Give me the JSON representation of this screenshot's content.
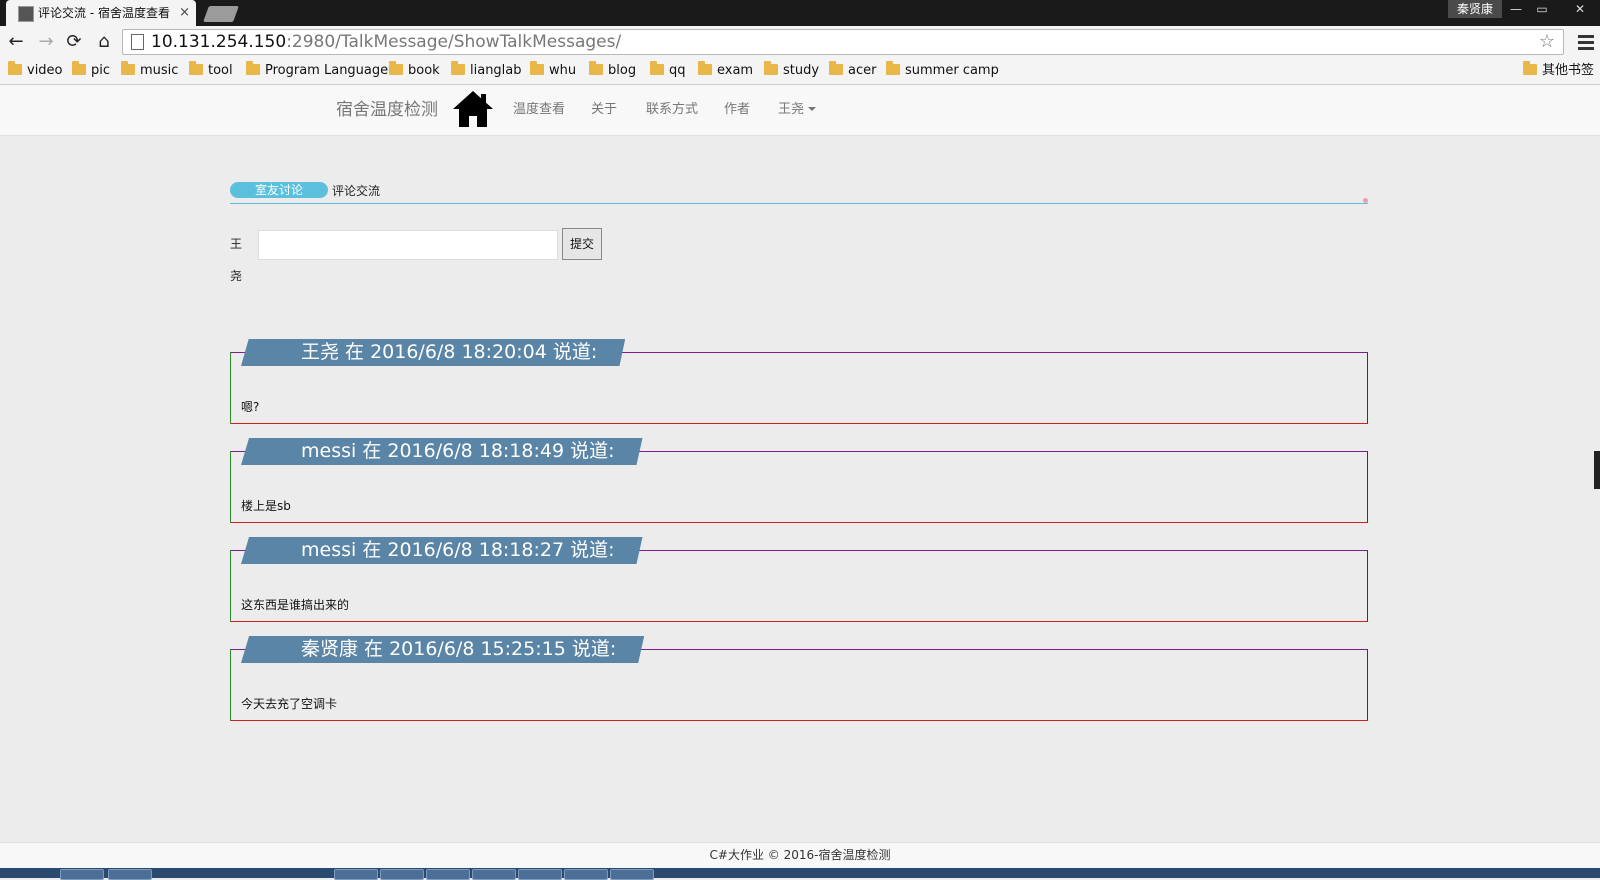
{
  "browser": {
    "tab_title": "评论交流 - 宿舍温度查看",
    "tab_close": "×",
    "user_badge": "秦贤康",
    "win_min": "—",
    "win_max": "▭",
    "win_close": "✕",
    "nav_back": "←",
    "nav_forward": "→",
    "nav_reload": "⟳",
    "nav_home": "⌂",
    "url_host": "10.131.254.150",
    "url_path": ":2980/TalkMessage/ShowTalkMessages/",
    "star": "☆",
    "bookmarks": [
      "video",
      "pic",
      "music",
      "tool",
      "Program Language",
      "book",
      "lianglab",
      "whu",
      "blog",
      "qq",
      "exam",
      "study",
      "acer",
      "summer camp"
    ],
    "other_bookmarks": "其他书签"
  },
  "navbar": {
    "brand": "宿舍温度检测",
    "links": [
      "温度查看",
      "关于",
      "联系方式",
      "作者"
    ],
    "user_menu": "王尧"
  },
  "section": {
    "pill": "室友讨论",
    "label": "评论交流"
  },
  "post_form": {
    "user": "王尧",
    "input_value": "",
    "submit": "提交"
  },
  "messages": [
    {
      "header": "王尧 在 2016/6/8 18:20:04 说道:",
      "body": "嗯?"
    },
    {
      "header": "messi 在 2016/6/8 18:18:49 说道:",
      "body": "楼上是sb"
    },
    {
      "header": "messi 在 2016/6/8 18:18:27 说道:",
      "body": "这东西是谁搞出来的"
    },
    {
      "header": "秦贤康 在 2016/6/8 15:25:15 说道:",
      "body": "今天去充了空调卡"
    }
  ],
  "footer": "C#大作业 © 2016-宿舍温度检测",
  "colors": {
    "accent_cyan": "#5bc0de",
    "message_header": "#5a85a6"
  }
}
